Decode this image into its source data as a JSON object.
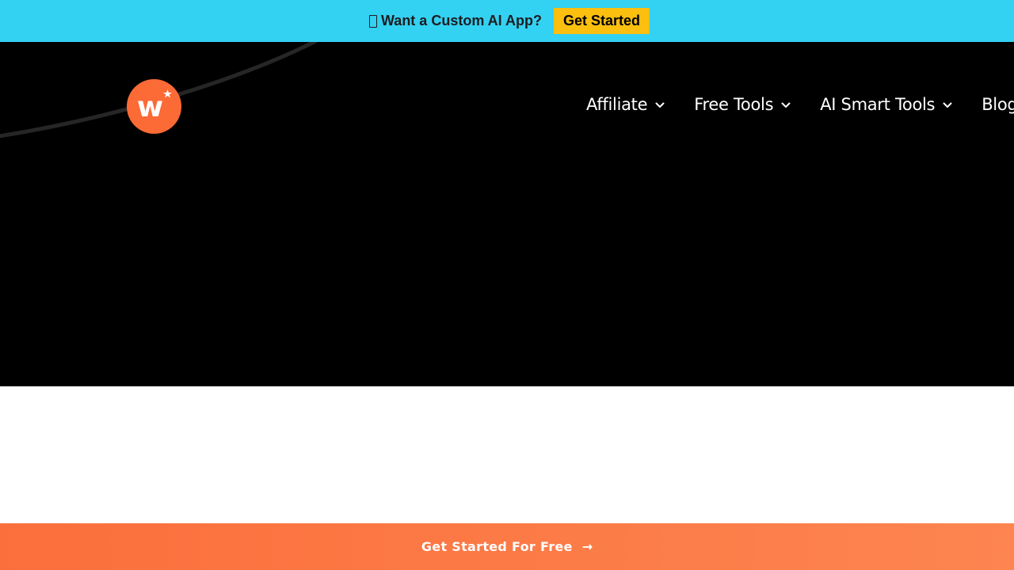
{
  "announcement": {
    "text": "Want a Custom AI App?",
    "emoji_icon": "missing-glyph-icon",
    "button_label": "Get Started",
    "background": "#33d1f2",
    "button_color": "#fbbf0f"
  },
  "header": {
    "background": "#000000",
    "logo": {
      "letter": "w",
      "color": "#fc6a36",
      "icon": "star-icon"
    },
    "nav": [
      {
        "label": "Affiliate",
        "has_dropdown": true
      },
      {
        "label": "Free Tools",
        "has_dropdown": true
      },
      {
        "label": "AI Smart Tools",
        "has_dropdown": true
      },
      {
        "label": "Blog",
        "has_dropdown": false
      }
    ]
  },
  "cta": {
    "label": "Get Started For Free",
    "arrow": "→",
    "gradient_start": "#fb6f3c",
    "gradient_end": "#fd8550"
  }
}
